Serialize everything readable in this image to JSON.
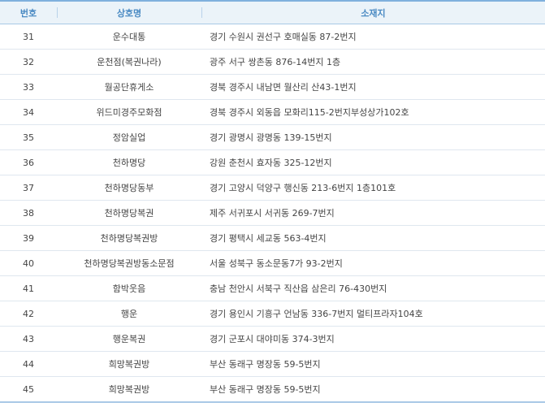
{
  "table": {
    "headers": {
      "number": "번호",
      "name": "상호명",
      "address": "소재지"
    },
    "rows": [
      {
        "number": "31",
        "name": "운수대통",
        "address": "경기 수원시 권선구 호매실동 87-2번지"
      },
      {
        "number": "32",
        "name": "운천점(복권나라)",
        "address": "광주 서구 쌍촌동 876-14번지 1층"
      },
      {
        "number": "33",
        "name": "월공단휴게소",
        "address": "경북 경주시 내남면 월산리 산43-1번지"
      },
      {
        "number": "34",
        "name": "위드미경주모화점",
        "address": "경북 경주시 외동읍 모화리115-2번지부성상가102호"
      },
      {
        "number": "35",
        "name": "정암실업",
        "address": "경기 광명시 광명동 139-15번지"
      },
      {
        "number": "36",
        "name": "천하명당",
        "address": "강원 춘천시 효자동 325-12번지"
      },
      {
        "number": "37",
        "name": "천하명당동부",
        "address": "경기 고양시 덕양구 행신동 213-6번지 1층101호"
      },
      {
        "number": "38",
        "name": "천하명당복권",
        "address": "제주 서귀포시 서귀동 269-7번지"
      },
      {
        "number": "39",
        "name": "천하명당복권방",
        "address": "경기 평택시 세교동 563-4번지"
      },
      {
        "number": "40",
        "name": "천하명당복권방동소문점",
        "address": "서울 성북구 동소문동7가 93-2번지"
      },
      {
        "number": "41",
        "name": "함박웃음",
        "address": "충남 천안시 서북구 직산읍 삼은리 76-430번지"
      },
      {
        "number": "42",
        "name": "행운",
        "address": "경기 용인시 기흥구 언남동 336-7번지 멀티프라자104호"
      },
      {
        "number": "43",
        "name": "행운복권",
        "address": "경기 군포시 대야미동 374-3번지"
      },
      {
        "number": "44",
        "name": "희망복권방",
        "address": "부산 동래구 명장동 59-5번지"
      },
      {
        "number": "45",
        "name": "희망복권방",
        "address": "부산 동래구 명장동 59-5번지"
      }
    ]
  }
}
